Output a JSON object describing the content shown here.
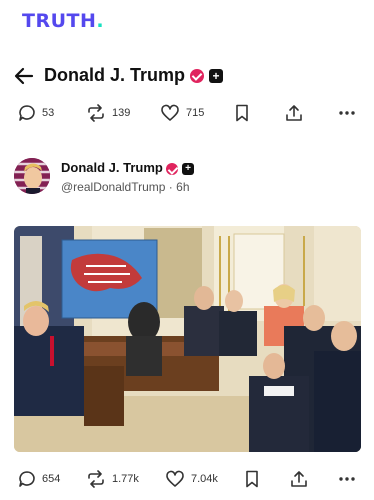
{
  "brand": {
    "logo_text": "TRUTH",
    "logo_dot": "."
  },
  "header": {
    "title": "Donald J. Trump"
  },
  "prev_post_actions": {
    "replies": "53",
    "retruths": "139",
    "likes": "715"
  },
  "post": {
    "author_name": "Donald J. Trump",
    "handle": "@realDonaldTrump",
    "time": "6h",
    "actions": {
      "replies": "654",
      "retruths": "1.77k",
      "likes": "7.04k"
    }
  },
  "colors": {
    "brand": "#5448ee",
    "brand_dot": "#17e0c0",
    "verified": "#e0245e"
  },
  "icons": [
    "back-arrow-icon",
    "verified-icon",
    "plus-badge-icon",
    "reply-icon",
    "retruth-icon",
    "like-icon",
    "bookmark-icon",
    "share-icon",
    "more-icon"
  ]
}
